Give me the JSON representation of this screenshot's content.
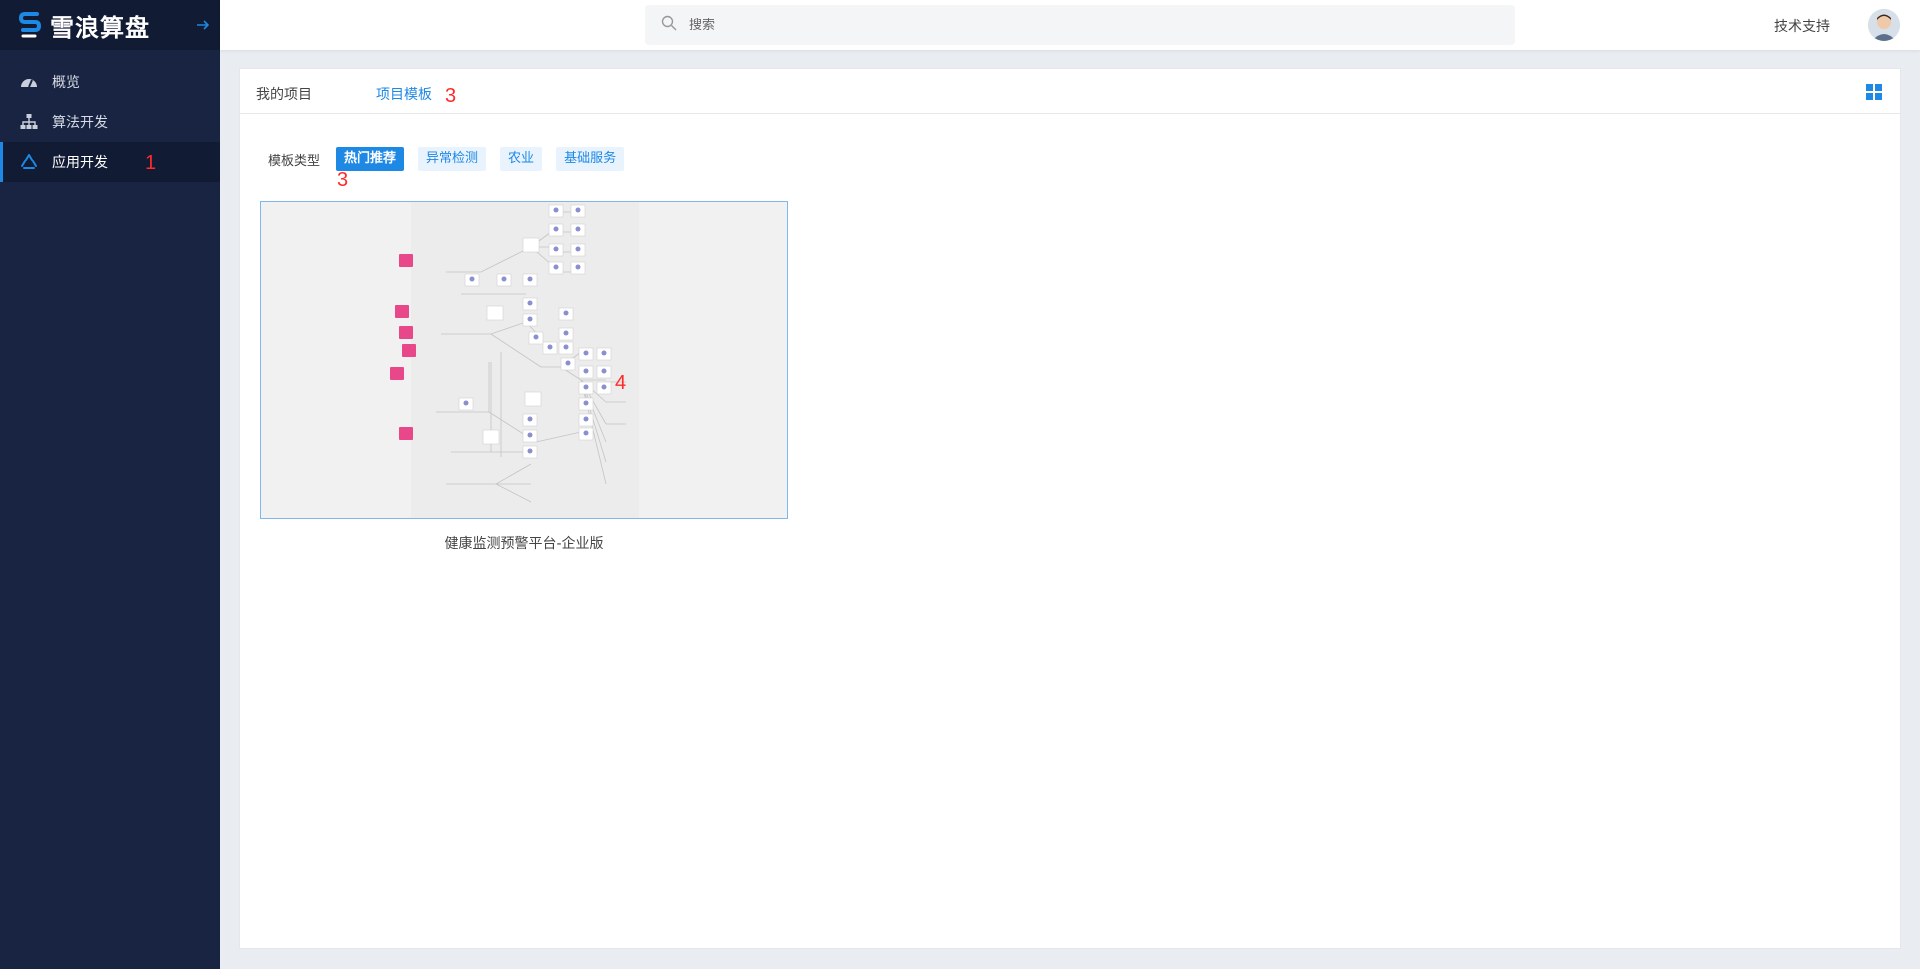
{
  "app": {
    "logo_text": "雪浪算盘"
  },
  "sidebar": {
    "items": [
      {
        "label": "概览",
        "icon": "dashboard-icon"
      },
      {
        "label": "算法开发",
        "icon": "org-chart-icon"
      },
      {
        "label": "应用开发",
        "icon": "recycle-icon",
        "active": true
      }
    ]
  },
  "header": {
    "search_placeholder": "搜索",
    "support_label": "技术支持"
  },
  "tabs": [
    {
      "label": "我的项目"
    },
    {
      "label": "项目模板",
      "active": true
    }
  ],
  "filters": {
    "label": "模板类型",
    "options": [
      {
        "label": "热门推荐",
        "active": true
      },
      {
        "label": "异常检测"
      },
      {
        "label": "农业"
      },
      {
        "label": "基础服务"
      }
    ]
  },
  "templates": [
    {
      "title": "健康监测预警平台-企业版"
    }
  ],
  "annotations": [
    "1",
    "3",
    "3",
    "4"
  ],
  "colors": {
    "accent": "#1e88e5",
    "sidebar_bg": "#182441",
    "annotation": "#ff2a2a",
    "source_node": "#e8488a"
  }
}
